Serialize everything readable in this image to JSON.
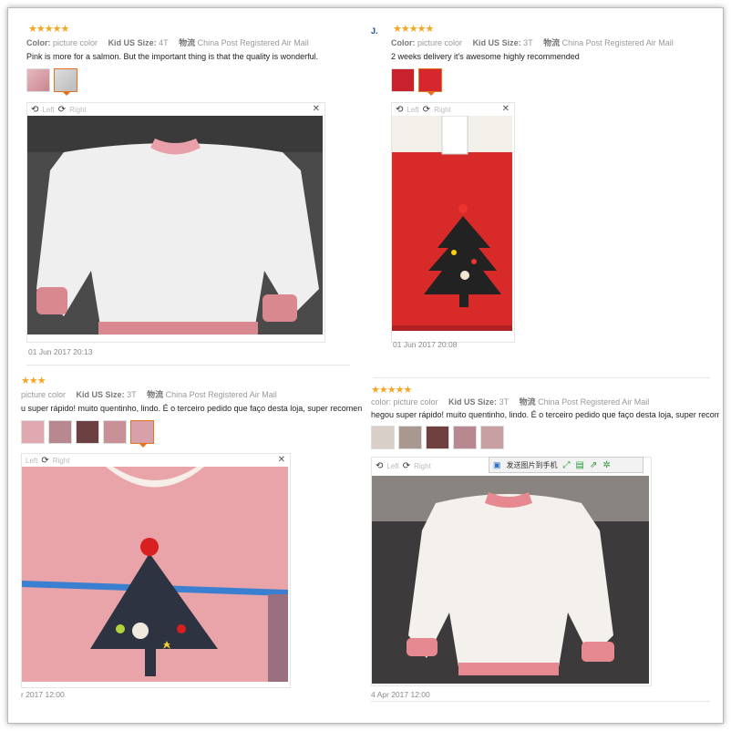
{
  "reviews": [
    {
      "initial": "",
      "stars": "★★★★★",
      "color_label": "Color:",
      "color_value": "picture color",
      "size_label": "Kid US Size:",
      "size_value": "4T",
      "ship_label": "物流",
      "ship_value": "China Post Registered Air Mail",
      "text": "Pink is more for a salmon. But the important thing is that the quality is wonderful.",
      "left_label": "Left",
      "right_label": "Right",
      "date": "01 Jun 2017 20:13"
    },
    {
      "initial": "J.",
      "stars": "★★★★★",
      "color_label": "Color:",
      "color_value": "picture color",
      "size_label": "Kid US Size:",
      "size_value": "3T",
      "ship_label": "物流",
      "ship_value": "China Post Registered Air Mail",
      "text": "2 weeks delivery it's awesome highly recommended",
      "left_label": "Left",
      "right_label": "Right",
      "date": "01 Jun 2017 20:08"
    },
    {
      "initial": "",
      "stars": "★★★",
      "color_label": "",
      "color_value": "picture color",
      "size_label": "Kid US Size:",
      "size_value": "3T",
      "ship_label": "物流",
      "ship_value": "China Post Registered Air Mail",
      "text": "u super rápido! muito quentinho, lindo. É o terceiro pedido que faço desta loja, super recomend",
      "left_label": "Left",
      "right_label": "Right",
      "date": "r 2017 12:00"
    },
    {
      "initial": "",
      "stars": "★★★★★",
      "color_label": "",
      "color_value": "color: picture color",
      "size_label": "Kid US Size:",
      "size_value": "3T",
      "ship_label": "物流",
      "ship_value": "China Post Registered Air Mail",
      "text": "hegou super rápido! muito quentinho, lindo. É o terceiro pedido que faço desta loja, super recomen",
      "left_label": "Left",
      "right_label": "Right",
      "send_label": "发送图片到手机",
      "date": "4 Apr 2017 12:00"
    }
  ],
  "colors": {
    "star": "#f5a623",
    "selected_thumb": "#e6721e",
    "toolbar_icon": "#2a9a3a"
  }
}
